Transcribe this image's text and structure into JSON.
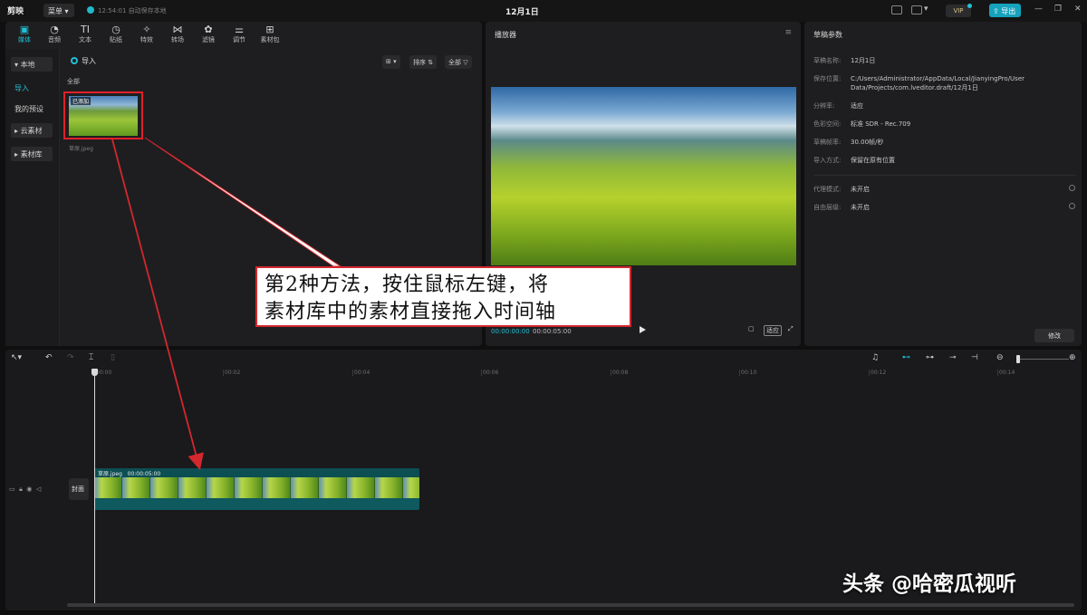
{
  "titlebar": {
    "app_name": "剪映",
    "menu_label": "菜单",
    "autosave": "12:54:01 自动保存本地",
    "project_title": "12月1日",
    "vip_label": "VIP",
    "export_label": "导出"
  },
  "media": {
    "tabs": [
      {
        "label": "媒体",
        "icon": "media-icon"
      },
      {
        "label": "音频",
        "icon": "audio-icon"
      },
      {
        "label": "文本",
        "icon": "text-icon"
      },
      {
        "label": "贴纸",
        "icon": "sticker-icon"
      },
      {
        "label": "特效",
        "icon": "effects-icon"
      },
      {
        "label": "转场",
        "icon": "transition-icon"
      },
      {
        "label": "滤镜",
        "icon": "filter-icon"
      },
      {
        "label": "调节",
        "icon": "adjust-icon"
      },
      {
        "label": "素材包",
        "icon": "package-icon"
      }
    ],
    "sidebar": [
      "本地",
      "导入",
      "我的预设",
      "云素材",
      "素材库"
    ],
    "import_label": "导入",
    "sort_label": "排序",
    "filter_label": "全部",
    "section_label": "全部",
    "item": {
      "added_tag": "已添加",
      "filename": "草原.jpeg"
    }
  },
  "player": {
    "title": "播放器",
    "current_time": "00:00:00:00",
    "total_time": "00:00:05:00",
    "ratio_label": "适应"
  },
  "params": {
    "title": "草稿参数",
    "rows": [
      {
        "k": "草稿名称:",
        "v": "12月1日"
      },
      {
        "k": "保存位置:",
        "v": "C:/Users/Administrator/AppData/Local/JianyingPro/User Data/Projects/com.lveditor.draft/12月1日"
      },
      {
        "k": "分辨率:",
        "v": "适应"
      },
      {
        "k": "色彩空间:",
        "v": "标准 SDR - Rec.709"
      },
      {
        "k": "草稿帧率:",
        "v": "30.00帧/秒"
      },
      {
        "k": "导入方式:",
        "v": "保留在原有位置"
      },
      {
        "k": "代理模式:",
        "v": "未开启"
      },
      {
        "k": "自由层级:",
        "v": "未开启"
      }
    ],
    "modify_label": "修改"
  },
  "timeline": {
    "ticks": [
      "00:00",
      "00:02",
      "00:04",
      "00:06",
      "00:08",
      "00:10",
      "00:12",
      "00:14"
    ],
    "cover_label": "封面",
    "clip_name": "草原.jpeg",
    "clip_duration": "00:00:05:00"
  },
  "annotation": {
    "line1": "第2种方法，按住鼠标左键，将",
    "line2": "素材库中的素材直接拖入时间轴"
  },
  "watermark": "头条 @哈密瓜视听",
  "colors": {
    "accent": "#21c0d6",
    "arrow": "#d2282e"
  }
}
